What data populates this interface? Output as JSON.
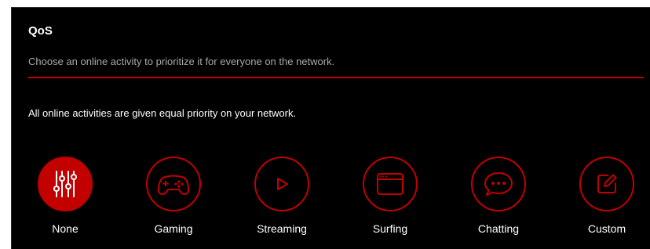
{
  "qos": {
    "title": "QoS",
    "subtitle": "Choose an online activity to prioritize it for everyone on the network.",
    "status_text": "All online activities are given equal priority on your network."
  },
  "activities": [
    {
      "label": "None",
      "icon": "sliders-icon",
      "selected": true
    },
    {
      "label": "Gaming",
      "icon": "gamepad-icon",
      "selected": false
    },
    {
      "label": "Streaming",
      "icon": "play-icon",
      "selected": false
    },
    {
      "label": "Surfing",
      "icon": "browser-window-icon",
      "selected": false
    },
    {
      "label": "Chatting",
      "icon": "chat-bubble-icon",
      "selected": false
    },
    {
      "label": "Custom",
      "icon": "edit-icon",
      "selected": false
    }
  ],
  "colors": {
    "accent": "#c30000",
    "background": "#000000",
    "text": "#ffffff",
    "muted_text": "#a9a9a9"
  }
}
